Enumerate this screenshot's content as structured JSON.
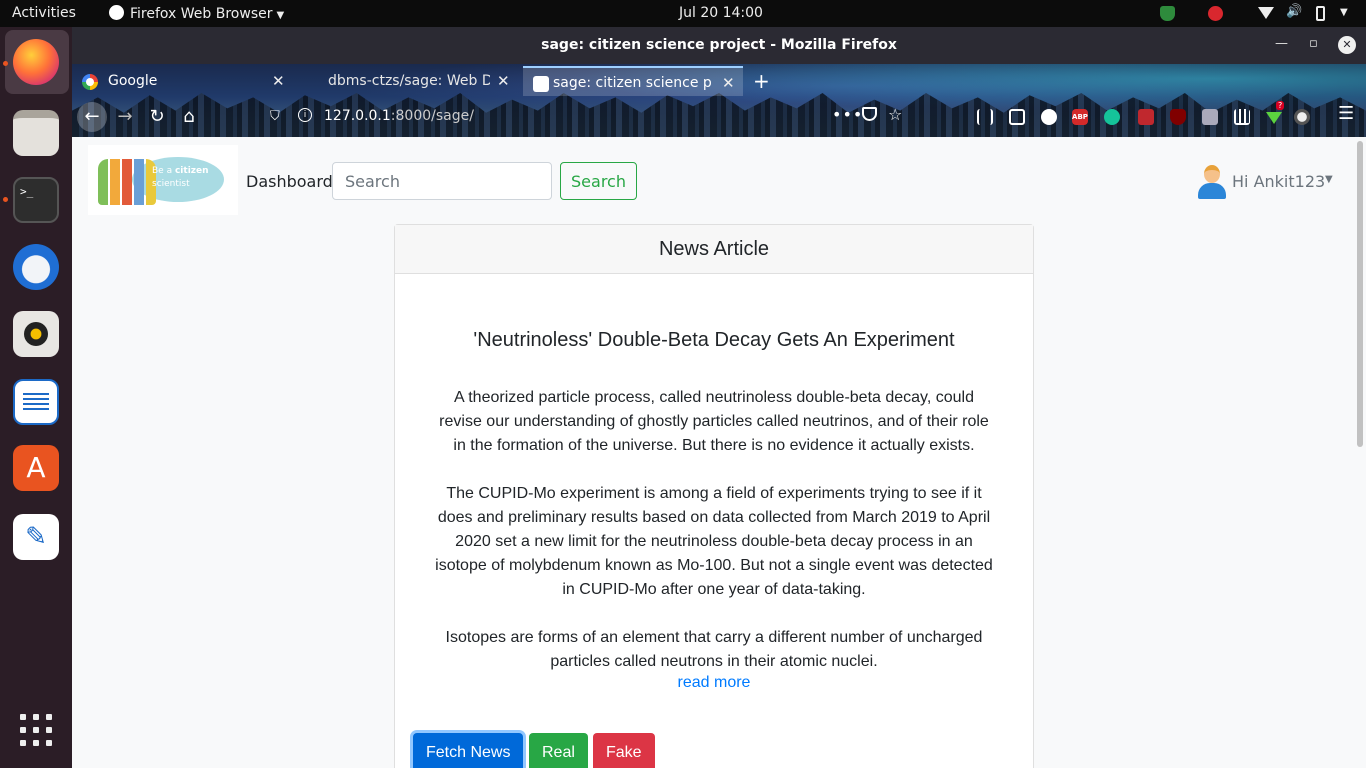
{
  "system": {
    "activities": "Activities",
    "app_menu": "Firefox Web Browser",
    "clock": "Jul 20  14:00"
  },
  "window": {
    "title": "sage: citizen science project - Mozilla Firefox"
  },
  "tabs": [
    {
      "label": "Google"
    },
    {
      "label": "dbms-ctzs/sage: Web De"
    },
    {
      "label": "sage: citizen science proj"
    }
  ],
  "url": {
    "host": "127.0.0.1",
    "path": ":8000/sage/"
  },
  "toolbar": {
    "abp_label": "ABP",
    "download_badge": "?"
  },
  "site": {
    "logo_text_1": "Be a",
    "logo_text_bold": "citizen",
    "logo_text_2": "scientist",
    "nav_dashboard": "Dashboard",
    "search_placeholder": "Search",
    "search_button": "Search",
    "user_greeting": "Hi Ankit123"
  },
  "card": {
    "header": "News Article",
    "article_title": "'Neutrinoless' Double-Beta Decay Gets An Experiment",
    "paragraphs": [
      "A theorized particle process, called neutrinoless double-beta decay, could revise our understanding of ghostly particles called neutrinos, and of their role in the formation of the universe. But there is no evidence it actually exists.",
      "The CUPID-Mo experiment is among a field of experiments trying to see if it does and preliminary results based on data collected from March 2019 to April 2020 set a new limit for the neutrinoless double-beta decay process in an isotope of molybdenum known as Mo-100. But not a single event was detected in CUPID-Mo after one year of data-taking.",
      "Isotopes are forms of an element that carry a different number of uncharged particles called neutrons in their atomic nuclei."
    ],
    "read_more": "read more",
    "buttons": {
      "fetch": "Fetch News",
      "real": "Real",
      "fake": "Fake"
    }
  },
  "colors": {
    "primary": "#007bff",
    "success": "#28a745",
    "danger": "#dc3545",
    "ubuntu_orange": "#e95420"
  }
}
